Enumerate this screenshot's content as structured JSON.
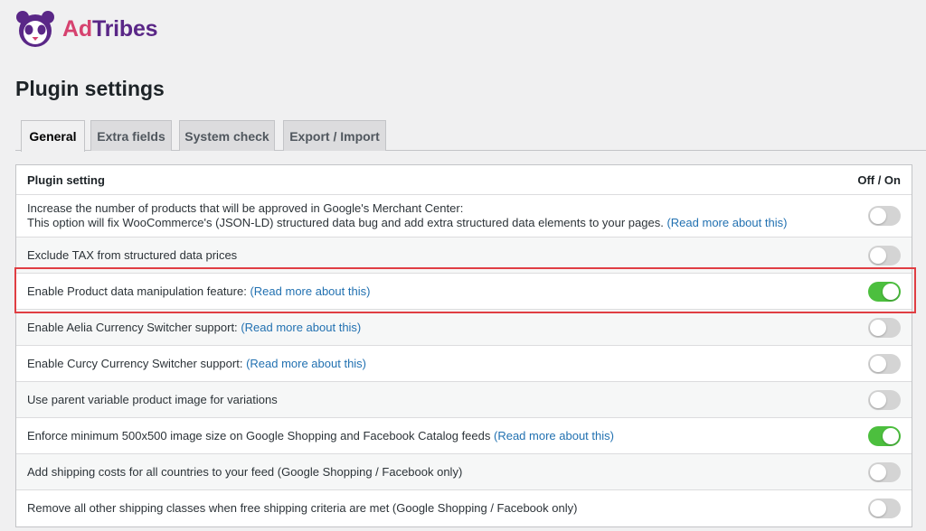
{
  "brand": {
    "name_part1": "Ad",
    "name_part2": "Tribes",
    "logo_icon": "panda-icon",
    "color_part1": "#d6426f",
    "color_part2": "#5a2787"
  },
  "page": {
    "title": "Plugin settings"
  },
  "tabs": [
    {
      "label": "General",
      "active": true
    },
    {
      "label": "Extra fields",
      "active": false
    },
    {
      "label": "System check",
      "active": false
    },
    {
      "label": "Export / Import",
      "active": false
    }
  ],
  "table": {
    "header_setting": "Plugin setting",
    "header_toggle": "Off / On",
    "rows": [
      {
        "line1": "Increase the number of products that will be approved in Google's Merchant Center:",
        "text": "This option will fix WooCommerce's (JSON-LD) structured data bug and add extra structured data elements to your pages.",
        "link": "(Read more about this)",
        "enabled": false
      },
      {
        "text": "Exclude TAX from structured data prices",
        "link": "",
        "enabled": false
      },
      {
        "text": "Enable Product data manipulation feature:",
        "link": "(Read more about this)",
        "enabled": true
      },
      {
        "text": "Enable Aelia Currency Switcher support:",
        "link": "(Read more about this)",
        "enabled": false
      },
      {
        "text": "Enable Curcy Currency Switcher support:",
        "link": "(Read more about this)",
        "enabled": false
      },
      {
        "text": "Use parent variable product image for variations",
        "link": "",
        "enabled": false
      },
      {
        "text": "Enforce minimum 500x500 image size on Google Shopping and Facebook Catalog feeds",
        "link": "(Read more about this)",
        "enabled": true
      },
      {
        "text": "Add shipping costs for all countries to your feed (Google Shopping / Facebook only)",
        "link": "",
        "enabled": false
      },
      {
        "text": "Remove all other shipping classes when free shipping criteria are met (Google Shopping / Facebook only)",
        "link": "",
        "enabled": false
      }
    ]
  },
  "colors": {
    "toggle_on": "#4cbf3e",
    "toggle_off": "#d4d4d4",
    "link": "#2271b1",
    "highlight": "#e03e43"
  }
}
